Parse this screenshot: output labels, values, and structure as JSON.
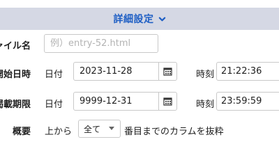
{
  "section": {
    "title": "詳細設定"
  },
  "filename": {
    "label": "ファイル名",
    "placeholder": "例）entry-52.html"
  },
  "publish_start": {
    "label": "公開開始日時",
    "date_label": "日付",
    "date_value": "2023-11-28",
    "time_label": "時刻",
    "time_value": "21:22:36"
  },
  "publish_end": {
    "label": "掲載期限",
    "date_label": "日付",
    "date_value": "9999-12-31",
    "time_label": "時刻",
    "time_value": "23:59:59"
  },
  "summary": {
    "label": "概要",
    "prefix": "上から",
    "select_value": "全て",
    "suffix": "番目までのカラムを抜粋"
  },
  "icons": {
    "chevron": "chevron-down-icon",
    "calendar": "calendar-icon"
  },
  "colors": {
    "header_bg": "#d5d8e4",
    "header_text": "#1f5fc4"
  }
}
